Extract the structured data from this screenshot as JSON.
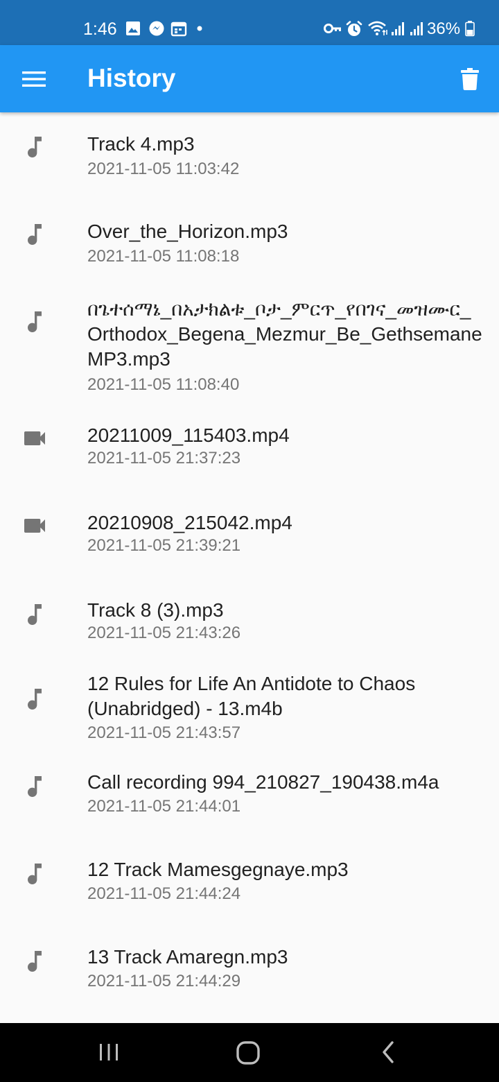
{
  "status_bar": {
    "time": "1:46",
    "battery_percent": "36%",
    "left_icons": [
      "image-icon",
      "messenger-icon",
      "calendar-icon",
      "dot-icon"
    ],
    "right_icons": [
      "vpn-key-icon",
      "alarm-icon",
      "wifi-icon",
      "signal-icon",
      "signal-icon",
      "battery-icon"
    ]
  },
  "app_bar": {
    "title": "History",
    "menu_icon": "hamburger-menu-icon",
    "action_icon": "trash-icon",
    "color": "#2196f3"
  },
  "history": [
    {
      "type": "audio",
      "icon": "music-note-icon",
      "title": "Track 4.mp3",
      "date": "2021-11-05 11:03:42"
    },
    {
      "type": "audio",
      "icon": "music-note-icon",
      "title": "Over_the_Horizon.mp3",
      "date": "2021-11-05 11:08:18"
    },
    {
      "type": "audio",
      "icon": "music-note-icon",
      "title": "በጌተሰማኔ_በአታክልቱ_ቦታ_ምርጥ_የበገና_መዝሙር_Orthodox_Begena_Mezmur_Be_GethsemaneMP3.mp3",
      "date": "2021-11-05 11:08:40"
    },
    {
      "type": "video",
      "icon": "video-camera-icon",
      "title": "20211009_115403.mp4",
      "date": "2021-11-05 21:37:23"
    },
    {
      "type": "video",
      "icon": "video-camera-icon",
      "title": "20210908_215042.mp4",
      "date": "2021-11-05 21:39:21"
    },
    {
      "type": "audio",
      "icon": "music-note-icon",
      "title": "Track 8 (3).mp3",
      "date": "2021-11-05 21:43:26"
    },
    {
      "type": "audio",
      "icon": "music-note-icon",
      "title": "12 Rules for Life An Antidote to Chaos (Unabridged) - 13.m4b",
      "date": "2021-11-05 21:43:57"
    },
    {
      "type": "audio",
      "icon": "music-note-icon",
      "title": "Call recording 994_210827_190438.m4a",
      "date": "2021-11-05 21:44:01"
    },
    {
      "type": "audio",
      "icon": "music-note-icon",
      "title": "12 Track Mamesgegnaye.mp3",
      "date": "2021-11-05 21:44:24"
    },
    {
      "type": "audio",
      "icon": "music-note-icon",
      "title": "13 Track Amaregn.mp3",
      "date": "2021-11-05 21:44:29"
    }
  ],
  "nav_bar": {
    "icons": [
      "recent-apps-icon",
      "home-icon",
      "back-icon"
    ]
  }
}
